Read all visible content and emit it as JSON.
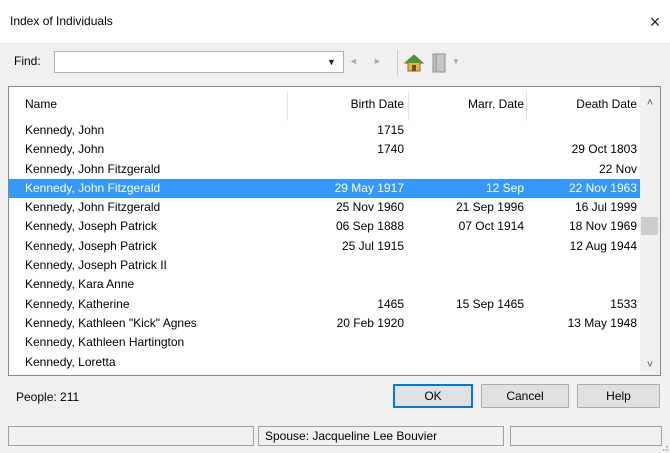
{
  "window": {
    "title": "Index of Individuals",
    "close_glyph": "×"
  },
  "find": {
    "label": "Find:",
    "value": "",
    "placeholder": ""
  },
  "toolbar": {
    "dropdown_glyph": "▼",
    "prev_glyph": "◄",
    "next_glyph": "►",
    "icons": [
      "home-icon",
      "book-icon"
    ]
  },
  "columns": {
    "name": "Name",
    "birth": "Birth Date",
    "marr": "Marr. Date",
    "death": "Death Date"
  },
  "rows": [
    {
      "name": "Kennedy, John",
      "birth": "1715",
      "marr": "",
      "death": ""
    },
    {
      "name": "Kennedy, John",
      "birth": "1740",
      "marr": "",
      "death": "29 Oct 1803"
    },
    {
      "name": "Kennedy, John Fitzgerald",
      "birth": "",
      "marr": "",
      "death": "22 Nov"
    },
    {
      "name": "Kennedy, John Fitzgerald",
      "birth": "29 May 1917",
      "marr": "12 Sep",
      "death": "22 Nov 1963"
    },
    {
      "name": "Kennedy, John Fitzgerald",
      "birth": "25 Nov 1960",
      "marr": "21 Sep 1996",
      "death": "16 Jul 1999"
    },
    {
      "name": "Kennedy, Joseph Patrick",
      "birth": "06 Sep 1888",
      "marr": "07 Oct 1914",
      "death": "18 Nov 1969"
    },
    {
      "name": "Kennedy, Joseph Patrick",
      "birth": "25 Jul 1915",
      "marr": "",
      "death": "12 Aug 1944"
    },
    {
      "name": "Kennedy, Joseph Patrick II",
      "birth": "",
      "marr": "",
      "death": ""
    },
    {
      "name": "Kennedy, Kara Anne",
      "birth": "",
      "marr": "",
      "death": ""
    },
    {
      "name": "Kennedy, Katherine",
      "birth": "1465",
      "marr": "15 Sep 1465",
      "death": "1533"
    },
    {
      "name": "Kennedy, Kathleen \"Kick\" Agnes",
      "birth": "20 Feb 1920",
      "marr": "",
      "death": "13 May 1948"
    },
    {
      "name": "Kennedy, Kathleen Hartington",
      "birth": "",
      "marr": "",
      "death": ""
    },
    {
      "name": "Kennedy, Loretta",
      "birth": "",
      "marr": "",
      "death": ""
    }
  ],
  "selected_row_index": 3,
  "footer": {
    "people": "People: 211"
  },
  "buttons": {
    "ok": "OK",
    "cancel": "Cancel",
    "help": "Help"
  },
  "status": {
    "panel1": "",
    "spouse": "Spouse: Jacqueline Lee Bouvier",
    "panel3": ""
  },
  "colors": {
    "selection": "#3399ff",
    "default_border": "#0078d7"
  }
}
